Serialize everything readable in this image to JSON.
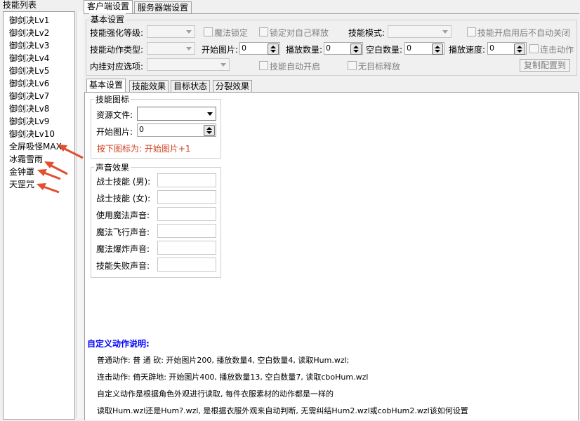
{
  "skill_list": {
    "title": "技能列表",
    "items": [
      "御剑决Lv1",
      "御剑决Lv2",
      "御剑决Lv3",
      "御剑决Lv4",
      "御剑决Lv5",
      "御剑决Lv6",
      "御剑决Lv7",
      "御剑决Lv8",
      "御剑决Lv9",
      "御剑决Lv10",
      "全屏吸怪MAX",
      "冰霜雪雨",
      "金钟罩",
      "天罡咒"
    ]
  },
  "top_tabs": [
    "客户端设置",
    "服务器端设置"
  ],
  "basic_settings": {
    "title": "基本设置",
    "skill_level_label": "技能强化等级:",
    "magic_lock_label": "魔法锁定",
    "lock_self_label": "锁定对自己释放",
    "skill_mode_label": "技能模式:",
    "no_auto_close_label": "技能开启用后不自动关闭",
    "action_type_label": "技能动作类型:",
    "start_image_label": "开始图片:",
    "start_image_value": "0",
    "play_count_label": "播放数量:",
    "play_count_value": "0",
    "blank_count_label": "空白数量:",
    "blank_count_value": "0",
    "play_speed_label": "播放速度:",
    "play_speed_value": "0",
    "combo_action_label": "连击动作",
    "hang_option_label": "内挂对应选项:",
    "auto_on_label": "技能自动开启",
    "no_target_label": "无目标释放",
    "copy_button": "复制配置到"
  },
  "inner_tabs": [
    "基本设置",
    "技能效果",
    "目标状态",
    "分裂效果"
  ],
  "skill_icon": {
    "title": "技能图标",
    "resource_label": "资源文件:",
    "start_image_label": "开始图片:",
    "start_image_value": "0",
    "hint": "按下图标为: 开始图片+1"
  },
  "sound": {
    "title": "声音效果",
    "fields": [
      "战士技能 (男):",
      "战士技能 (女):",
      "使用魔法声音:",
      "魔法飞行声音:",
      "魔法爆炸声音:",
      "技能失败声音:"
    ]
  },
  "custom_action": {
    "title": "自定义动作说明:",
    "lines": [
      "普通动作: 普 通 砍: 开始图片200, 播放数量4, 空白数量4, 读取Hum.wzl;",
      "连击动作: 倚天辟地: 开始图片400, 播放数量13, 空白数量7, 读取cboHum.wzl",
      "自定义动作是根据角色外观进行读取, 每件衣服素材的动作都是一样的",
      "读取Hum.wzl还是Hum?.wzl, 是根据衣服外观来自动判断, 无需纠结Hum2.wzl或cobHum2.wzl该如何设置"
    ]
  },
  "colors": {
    "hint": "#d04020",
    "title_blue": "#0000ff",
    "arrow": "#e05030"
  }
}
